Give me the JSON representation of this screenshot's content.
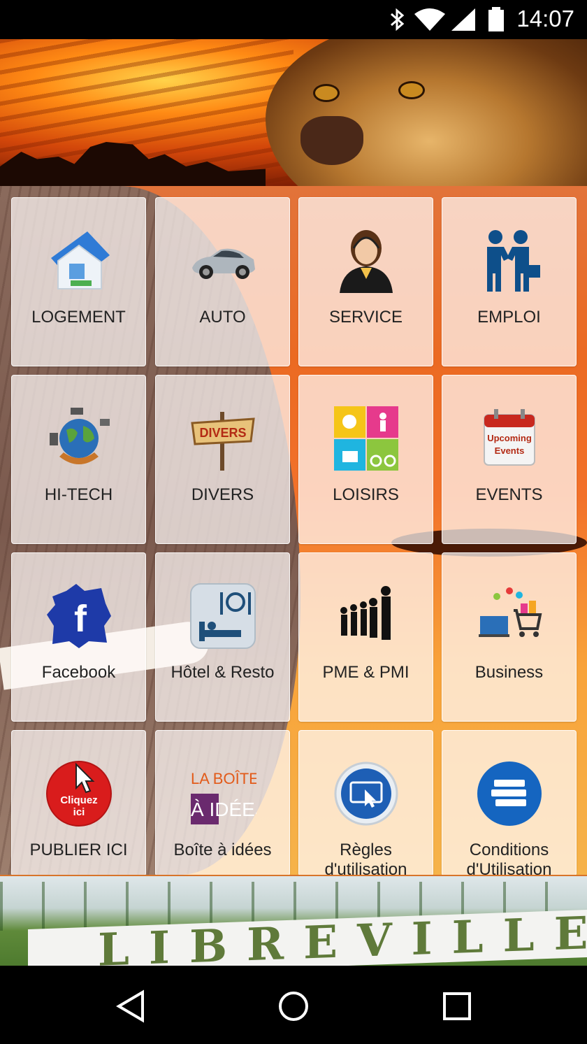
{
  "status_bar": {
    "time": "14:07",
    "icons": [
      "bluetooth-icon",
      "wifi-icon",
      "signal-icon",
      "battery-icon"
    ]
  },
  "header": {
    "image": "lion-savanna-banner"
  },
  "tiles": [
    {
      "label": "LOGEMENT",
      "icon": "house-icon"
    },
    {
      "label": "AUTO",
      "icon": "car-icon"
    },
    {
      "label": "SERVICE",
      "icon": "customer-service-icon"
    },
    {
      "label": "EMPLOI",
      "icon": "handshake-icon"
    },
    {
      "label": "HI-TECH",
      "icon": "globe-devices-icon"
    },
    {
      "label": "DIVERS",
      "icon": "divers-sign-icon",
      "icon_text": "DIVERS"
    },
    {
      "label": "LOISIRS",
      "icon": "leisure-icon"
    },
    {
      "label": "EVENTS",
      "icon": "calendar-icon",
      "icon_text": "Upcoming Events"
    },
    {
      "label": "Facebook",
      "icon": "facebook-icon"
    },
    {
      "label": "Hôtel & Resto",
      "icon": "hotel-restaurant-icon"
    },
    {
      "label": "PME & PMI",
      "icon": "business-people-icon"
    },
    {
      "label": "Business",
      "icon": "ecommerce-icon"
    },
    {
      "label": "PUBLIER ICI",
      "icon": "click-here-icon",
      "icon_text": "Cliquez ici"
    },
    {
      "label": "Boîte à idées",
      "icon": "idea-box-icon",
      "icon_text_line1": "LA BOÎTE",
      "icon_text_line2": "À IDÉES"
    },
    {
      "label": "Règles d'utilisation",
      "icon": "tablet-touch-icon"
    },
    {
      "label": "Conditions d'Utilisation",
      "icon": "books-icon"
    }
  ],
  "footer_banner": {
    "sign_text": "LIBREVILLE"
  },
  "nav_bar": {
    "buttons": [
      "back-icon",
      "home-icon",
      "recents-icon"
    ]
  },
  "colors": {
    "accent_orange": "#eb6a22",
    "tile_background": "#fffaf8",
    "facebook_blue": "#1e3aa8",
    "click_red": "#d91c1c",
    "info_blue": "#1565c0"
  }
}
